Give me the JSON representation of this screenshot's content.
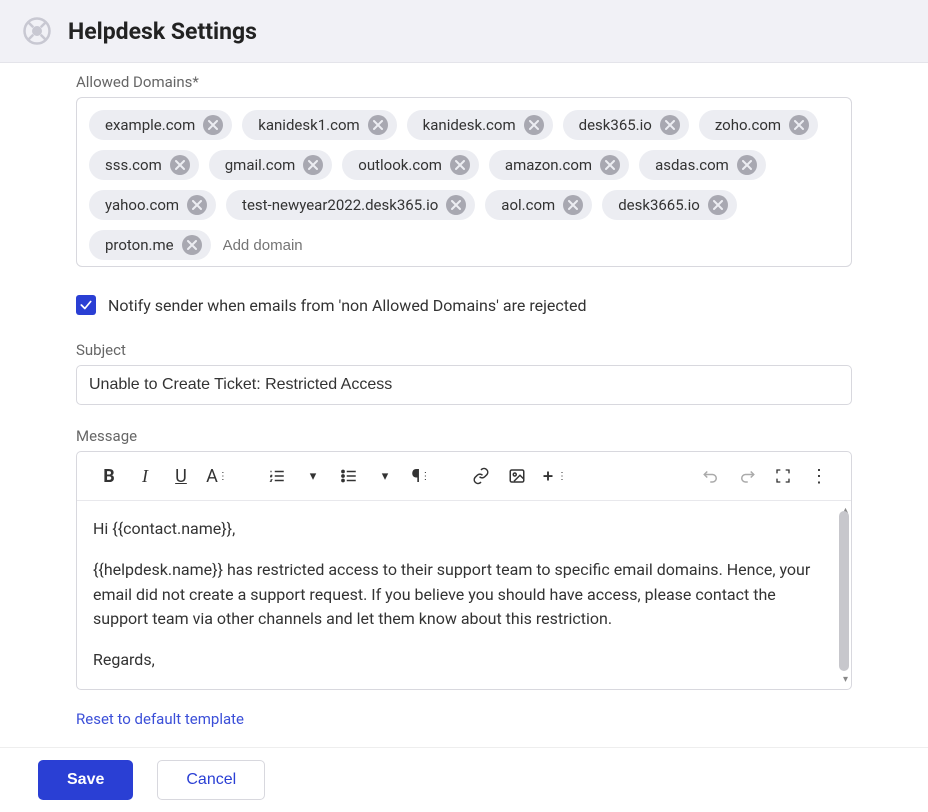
{
  "header": {
    "title": "Helpdesk Settings"
  },
  "allowedDomains": {
    "label": "Allowed Domains*",
    "placeholder": "Add domain",
    "items": [
      "example.com",
      "kanidesk1.com",
      "kanidesk.com",
      "desk365.io",
      "zoho.com",
      "sss.com",
      "gmail.com",
      "outlook.com",
      "amazon.com",
      "asdas.com",
      "yahoo.com",
      "test-newyear2022.desk365.io",
      "aol.com",
      "desk3665.io",
      "proton.me"
    ]
  },
  "notify": {
    "checked": true,
    "label": "Notify sender when emails from 'non Allowed Domains' are rejected"
  },
  "subject": {
    "label": "Subject",
    "value": "Unable to Create Ticket: Restricted Access"
  },
  "message": {
    "label": "Message",
    "body_line1": "Hi {{contact.name}},",
    "body_line2": "{{helpdesk.name}} has restricted access to their support team to specific email domains. Hence, your email did not create a support request. If you believe you should have access, please contact the support team via other channels and let them know about this restriction.",
    "body_line3": "Regards,"
  },
  "resetLink": "Reset to default template",
  "footer": {
    "save": "Save",
    "cancel": "Cancel"
  }
}
